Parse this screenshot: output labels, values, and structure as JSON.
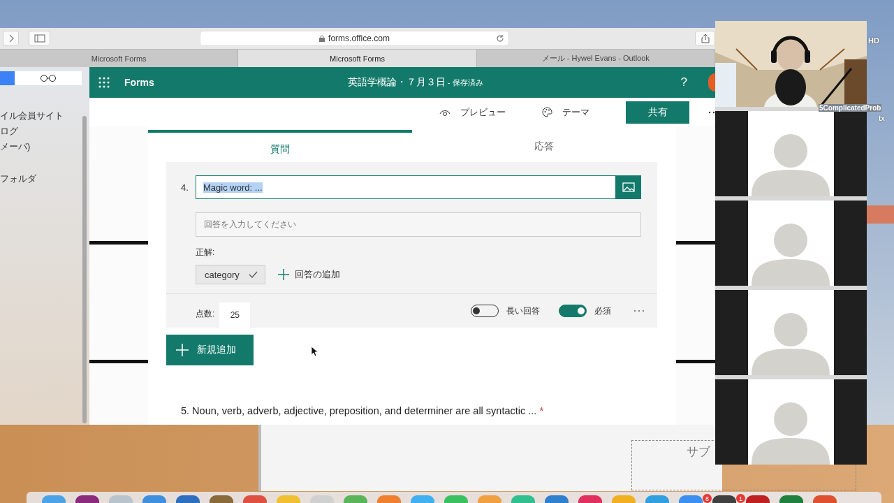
{
  "browser": {
    "address": "forms.office.com",
    "tabs": [
      {
        "label": "Microsoft Forms",
        "selected": false
      },
      {
        "label": "Microsoft Forms",
        "selected": true
      },
      {
        "label": "メール - Hywel Evans - Outlook",
        "selected": false
      }
    ],
    "sidebar": {
      "items": [
        "イル会員サイト",
        "ログ",
        "メーバ)",
        "フォルダ"
      ]
    }
  },
  "forms": {
    "app_name": "Forms",
    "title": "英語学概論・７月３日",
    "save_status": " - 保存済み",
    "help": "?",
    "commands": [
      {
        "label": "プレビュー",
        "kind": "preview"
      },
      {
        "label": "テーマ",
        "kind": "theme"
      }
    ],
    "share": "共有",
    "tabs": [
      {
        "label": "質問",
        "selected": true
      },
      {
        "label": "応答",
        "selected": false
      }
    ],
    "question": {
      "number": "4.",
      "title": "Magic word: ...",
      "title_selected": true,
      "answer_placeholder": "回答を入力してください",
      "correct_label": "正解:",
      "answers": [
        "category"
      ],
      "add_answer": "回答の追加",
      "points_label": "点数:",
      "points": "25",
      "options": [
        {
          "label": "長い回答",
          "on": false
        },
        {
          "label": "必須",
          "on": true
        }
      ]
    },
    "add_new": "新規追加",
    "next_question": {
      "text": "5. Noun, verb, adverb, adjective, preposition, and determiner are all syntactic ...",
      "required": true,
      "required_mark": "*"
    }
  },
  "behind_window": {
    "text": "サブ"
  },
  "desktop": {
    "labels": [
      "HD",
      "5ComplicatedProb",
      "tx"
    ]
  },
  "dock": {
    "badges": [
      "8",
      "1"
    ]
  },
  "meeting": {
    "participants": [
      {
        "kind": "video"
      },
      {
        "kind": "avatar"
      },
      {
        "kind": "avatar"
      },
      {
        "kind": "avatar"
      },
      {
        "kind": "avatar"
      }
    ]
  }
}
